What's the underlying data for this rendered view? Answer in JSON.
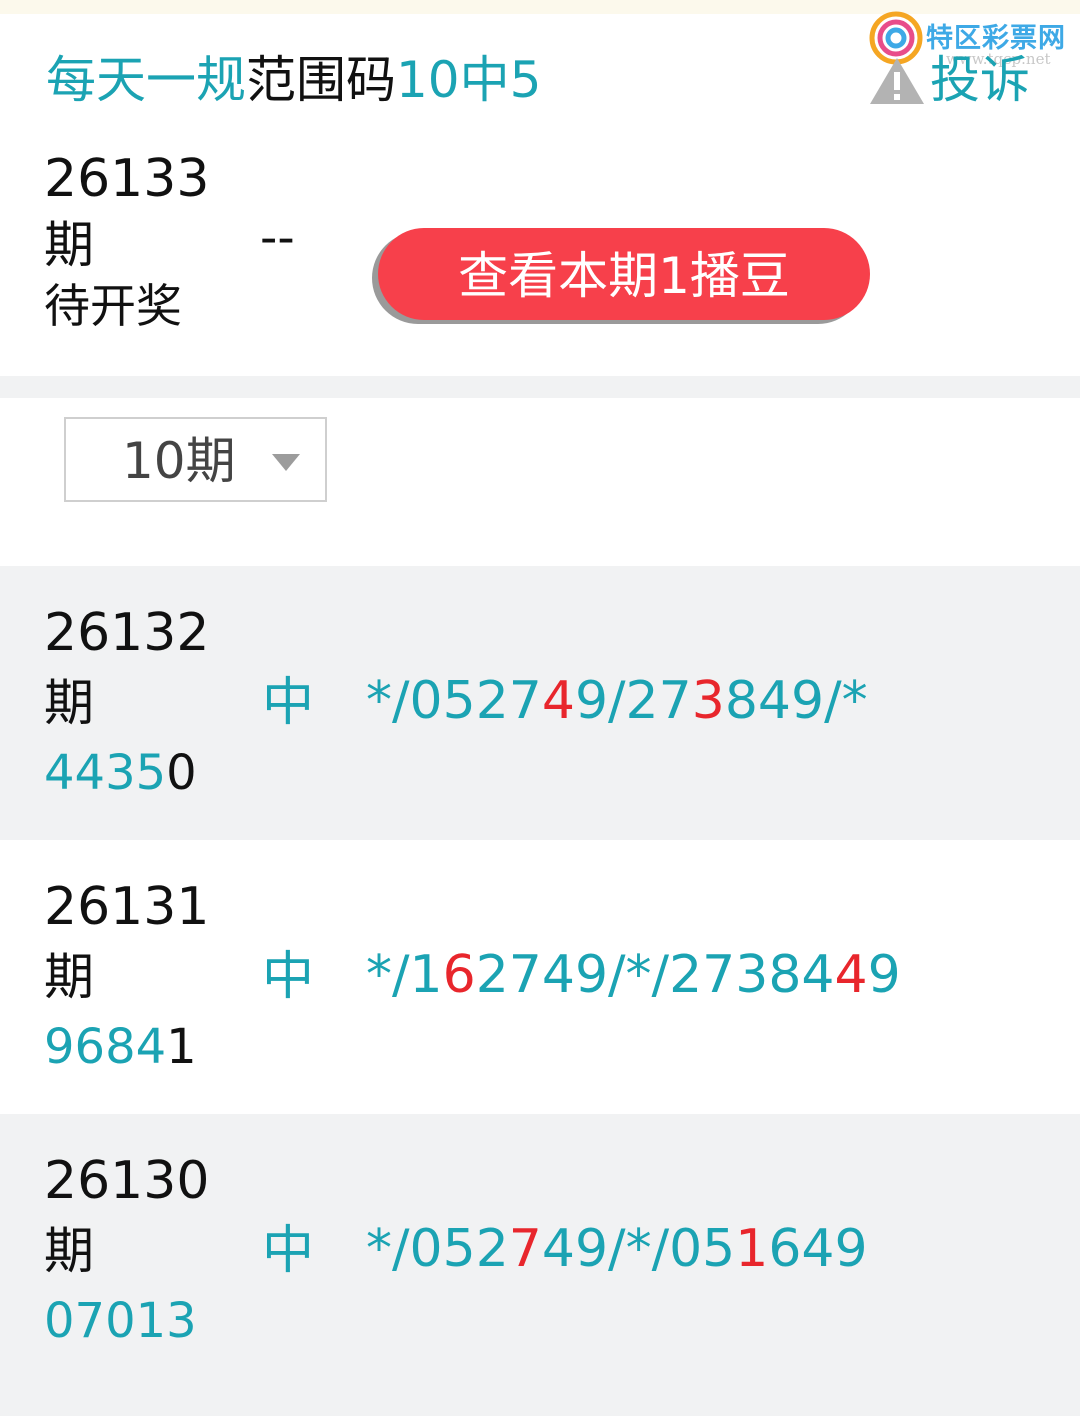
{
  "watermark": {
    "name": "特区彩票网",
    "url": "www.tqcp.net"
  },
  "header": {
    "title_parts": [
      {
        "text": "每天一规",
        "color": "teal"
      },
      {
        "text": "范围码",
        "color": "black"
      },
      {
        "text": "10中5",
        "color": "teal"
      }
    ],
    "complain_label": "投诉"
  },
  "current": {
    "issue_no": "26133",
    "issue_suffix": "期",
    "status": "待开奖",
    "result": "--",
    "button_label": "查看本期1播豆"
  },
  "filter": {
    "selected": "10期"
  },
  "records": [
    {
      "issue_no": "26132",
      "issue_suffix": "期",
      "hit": "中",
      "result_parts": [
        {
          "text": "4435",
          "color": "teal"
        },
        {
          "text": "0",
          "color": "black"
        }
      ],
      "pattern_parts": [
        {
          "text": "*/0527",
          "color": "teal"
        },
        {
          "text": "4",
          "color": "red"
        },
        {
          "text": "9/27",
          "color": "teal"
        },
        {
          "text": "3",
          "color": "red"
        },
        {
          "text": "849/*",
          "color": "teal"
        }
      ]
    },
    {
      "issue_no": "26131",
      "issue_suffix": "期",
      "hit": "中",
      "result_parts": [
        {
          "text": "9684",
          "color": "teal"
        },
        {
          "text": "1",
          "color": "black"
        }
      ],
      "pattern_parts": [
        {
          "text": "*/1",
          "color": "teal"
        },
        {
          "text": "6",
          "color": "red"
        },
        {
          "text": "2749/*/27384",
          "color": "teal"
        },
        {
          "text": "4",
          "color": "red"
        },
        {
          "text": "9",
          "color": "teal"
        }
      ]
    },
    {
      "issue_no": "26130",
      "issue_suffix": "期",
      "hit": "中",
      "result_parts": [
        {
          "text": "07013",
          "color": "teal"
        }
      ],
      "pattern_parts": [
        {
          "text": "*/052",
          "color": "teal"
        },
        {
          "text": "7",
          "color": "red"
        },
        {
          "text": "49/*/05",
          "color": "teal"
        },
        {
          "text": "1",
          "color": "red"
        },
        {
          "text": "649",
          "color": "teal"
        }
      ]
    }
  ],
  "colors": {
    "teal": "#1ba3b3",
    "red": "#e8262c",
    "black": "#111111",
    "button": "#f7404b"
  },
  "icons": {
    "warning": "warning-triangle-icon",
    "dropdown": "caret-down-icon",
    "logo": "spiral-logo-icon"
  }
}
